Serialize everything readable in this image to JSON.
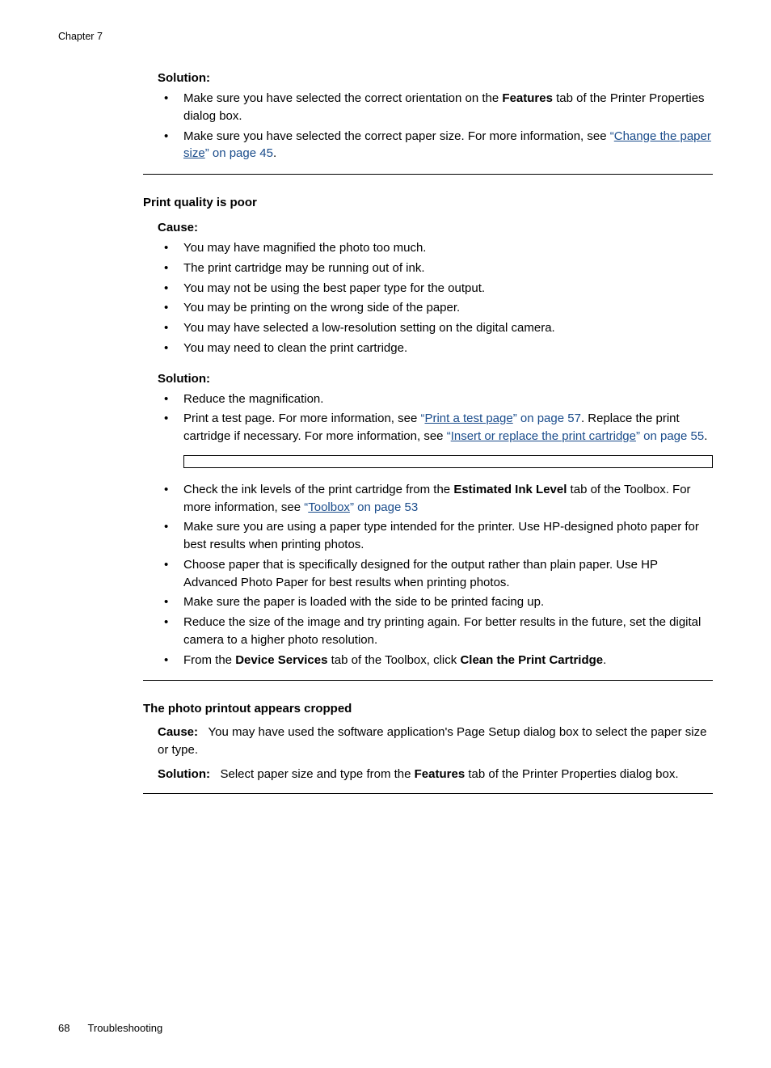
{
  "header": {
    "chapter": "Chapter 7"
  },
  "section1": {
    "title": "Solution:",
    "b1_pre": "Make sure you have selected the correct orientation on the ",
    "b1_bold": "Features",
    "b1_post": " tab of the Printer Properties dialog box.",
    "b2_pre": "Make sure you have selected the correct paper size. For more information, see ",
    "b2_link_q1": "“",
    "b2_link_text": "Change the paper size",
    "b2_link_q2": "” on page 45",
    "b2_post": "."
  },
  "section2": {
    "heading": "Print quality is poor",
    "cause_title": "Cause:",
    "cause_items": [
      "You may have magnified the photo too much.",
      "The print cartridge may be running out of ink.",
      "You may not be using the best paper type for the output.",
      "You may be printing on the wrong side of the paper.",
      "You may have selected a low-resolution setting on the digital camera.",
      "You may need to clean the print cartridge."
    ],
    "sol_title": "Solution:",
    "sol_b1": "Reduce the magnification.",
    "sol_b2_pre": "Print a test page. For more information, see ",
    "sol_b2_q1": "“",
    "sol_b2_link1": "Print a test page",
    "sol_b2_q2": "” on page 57",
    "sol_b2_mid": ". Replace the print cartridge if necessary. For more information, see ",
    "sol_b2_q3": "“",
    "sol_b2_link2": "Insert or replace the print cartridge",
    "sol_b2_q4": "” on page 55",
    "sol_b2_post": ".",
    "sol_b3_pre": "Check the ink levels of the print cartridge from the ",
    "sol_b3_bold": "Estimated Ink Level",
    "sol_b3_mid": " tab of the Toolbox. For more information, see ",
    "sol_b3_q1": "“",
    "sol_b3_link": "Toolbox",
    "sol_b3_q2": "” on page 53",
    "sol_b4": "Make sure you are using a paper type intended for the printer. Use HP-designed photo paper for best results when printing photos.",
    "sol_b5": "Choose paper that is specifically designed for the output rather than plain paper. Use HP Advanced Photo Paper for best results when printing photos.",
    "sol_b6": "Make sure the paper is loaded with the side to be printed facing up.",
    "sol_b7": "Reduce the size of the image and try printing again. For better results in the future, set the digital camera to a higher photo resolution.",
    "sol_b8_pre": "From the ",
    "sol_b8_bold1": "Device Services",
    "sol_b8_mid": " tab of the Toolbox, click ",
    "sol_b8_bold2": "Clean the Print Cartridge",
    "sol_b8_post": "."
  },
  "section3": {
    "heading": "The photo printout appears cropped",
    "cause_label": "Cause:",
    "cause_text": "You may have used the software application's Page Setup dialog box to select the paper size or type.",
    "sol_label": "Solution:",
    "sol_pre": "Select paper size and type from the ",
    "sol_bold": "Features",
    "sol_post": " tab of the Printer Properties dialog box."
  },
  "footer": {
    "page_number": "68",
    "section": "Troubleshooting"
  }
}
